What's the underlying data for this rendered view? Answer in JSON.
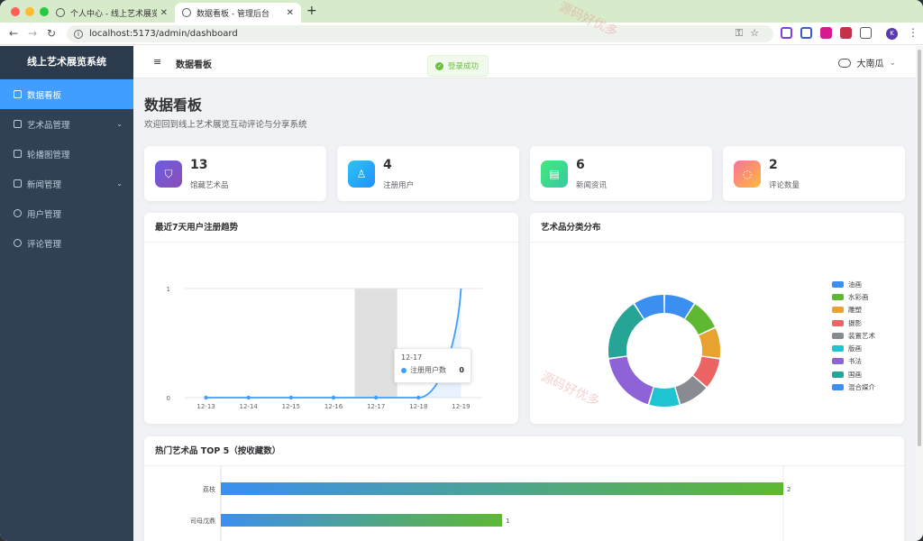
{
  "browser": {
    "tabs": [
      {
        "title": "个人中心 - 线上艺术展览互动评论"
      },
      {
        "title": "数据看板 - 管理后台"
      }
    ],
    "url": "localhost:5173/admin/dashboard",
    "profile_initial": "K"
  },
  "sidebar": {
    "logo": "线上艺术展览系统",
    "items": [
      {
        "label": "数据看板",
        "icon": "dashboard-icon",
        "active": true
      },
      {
        "label": "艺术品管理",
        "icon": "bag-icon",
        "submenu": true
      },
      {
        "label": "轮播图管理",
        "icon": "image-icon"
      },
      {
        "label": "新闻管理",
        "icon": "document-icon",
        "submenu": true
      },
      {
        "label": "用户管理",
        "icon": "user-icon"
      },
      {
        "label": "评论管理",
        "icon": "chat-icon"
      }
    ]
  },
  "header": {
    "breadcrumb": "数据看板",
    "user_name": "大南瓜"
  },
  "toast": {
    "message": "登录成功"
  },
  "page": {
    "title": "数据看板",
    "subtitle": "欢迎回到线上艺术展览互动评论与分享系统"
  },
  "stats": [
    {
      "value": "13",
      "label": "馆藏艺术品",
      "icon": "bag-icon",
      "gradient": [
        "#6c5ce7",
        "#8a4fb3"
      ]
    },
    {
      "value": "4",
      "label": "注册用户",
      "icon": "user-icon",
      "gradient": [
        "#2ec4f0",
        "#1e90ff"
      ]
    },
    {
      "value": "6",
      "label": "新闻资讯",
      "icon": "document-icon",
      "gradient": [
        "#43e97b",
        "#38c9a3"
      ]
    },
    {
      "value": "2",
      "label": "评论数量",
      "icon": "chat-icon",
      "gradient": [
        "#fa709a",
        "#fdba3b"
      ]
    }
  ],
  "chart_data": [
    {
      "type": "line",
      "title": "最近7天用户注册趋势",
      "categories": [
        "12-13",
        "12-14",
        "12-15",
        "12-16",
        "12-17",
        "12-18",
        "12-19"
      ],
      "series": [
        {
          "name": "注册用户数",
          "values": [
            0,
            0,
            0,
            0,
            0,
            0,
            1
          ]
        }
      ],
      "ylim": [
        0,
        1
      ],
      "yticks": [
        "0",
        "1"
      ],
      "tooltip": {
        "category": "12-17",
        "series": "注册用户数",
        "value": "0"
      },
      "color": "#409eff"
    },
    {
      "type": "pie",
      "title": "艺术品分类分布",
      "legend_position": "right",
      "slices": [
        {
          "name": "油画",
          "value": 1,
          "color": "#3b8ff0"
        },
        {
          "name": "水彩画",
          "value": 1,
          "color": "#5fb832"
        },
        {
          "name": "雕塑",
          "value": 1,
          "color": "#e8a230"
        },
        {
          "name": "摄影",
          "value": 1,
          "color": "#ed6464"
        },
        {
          "name": "装置艺术",
          "value": 1,
          "color": "#888c92"
        },
        {
          "name": "版画",
          "value": 1,
          "color": "#1fc4d2"
        },
        {
          "name": "书法",
          "value": 2,
          "color": "#8e63d8"
        },
        {
          "name": "国画",
          "value": 2,
          "color": "#26a597"
        },
        {
          "name": "混合媒介",
          "value": 1,
          "color": "#3b8ff0"
        }
      ]
    },
    {
      "type": "bar",
      "title": "热门艺术品 TOP 5（按收藏数）",
      "orientation": "horizontal",
      "categories": [
        "荔枝",
        "司母戊鼎"
      ],
      "values": [
        2,
        1
      ],
      "xlim": [
        0,
        2
      ]
    }
  ],
  "watermark": "源码好优多"
}
